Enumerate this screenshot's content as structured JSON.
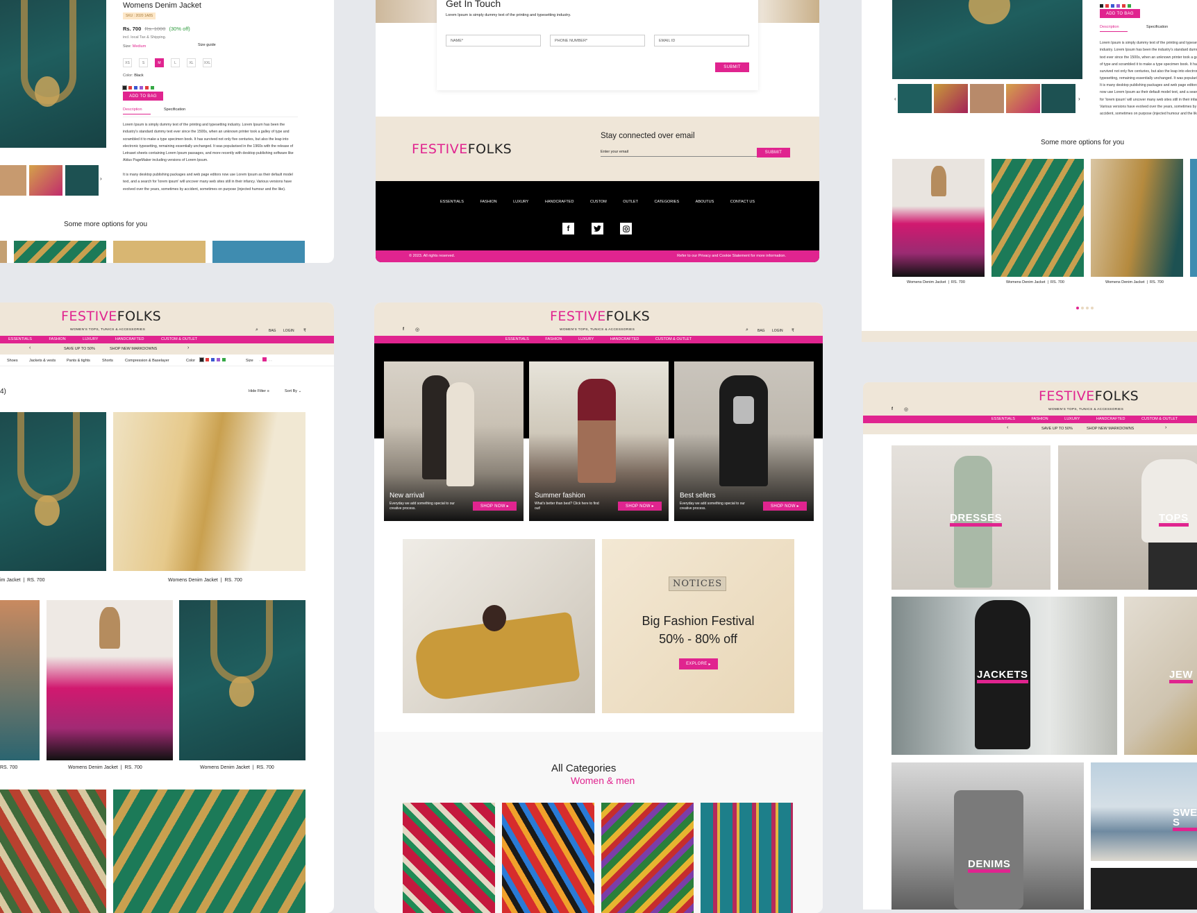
{
  "brand": {
    "part1": "FESTIVE",
    "part2": "FOLKS",
    "tagline": "WOMEN'S TOPS, TUNICS & ACCESSORIES"
  },
  "colors": {
    "accent": "#e0248f",
    "beige": "#efe6d8",
    "dark": "#000000"
  },
  "product": {
    "title": "Womens Denim Jacket",
    "sku": "SKU : 2020 1A8S",
    "price": "Rs. 700",
    "old_price": "Rs. 1000",
    "discount": "(30% off)",
    "tax": "incl. local Tax & Shipping.",
    "size_label": "Size:",
    "size_value": "Medium",
    "size_guide": "Size guide",
    "sizes": [
      "XS",
      "S",
      "M",
      "L",
      "XL",
      "XXL"
    ],
    "color_label": "Color:",
    "color_value": "Black",
    "add_to_bag": "ADD TO BAG",
    "tab_desc": "Description",
    "tab_spec": "Specification",
    "desc1": "Lorem Ipsum is simply dummy text of the printing and typesetting industry. Lorem Ipsum has been the industry's standard dummy text ever since the 1500s, when an unknown printer took a galley of type and scrambled it to make a type specimen book. It has survived not only five centuries, but also the leap into electronic typesetting, remaining essentially unchanged. It was popularised in the 1960s with the release of Letraset sheets containing Lorem Ipsum passages, and more recently with desktop publishing software like Aldus PageMaker including versions of Lorem Ipsum.",
    "desc2": "It is many desktop publishing packages and web page editors now use Lorem Ipsum as their default model text, and a search for 'lorem ipsum' will uncover many web sites still in their infancy. Various versions have evolved over the years, sometimes by accident, sometimes on purpose (injected humour and the like).",
    "more_options": "Some more options for you"
  },
  "contact": {
    "title": "Get In Touch",
    "subtitle": "Lorem Ipsum is simply dummy text of the printing and typesetting industry.",
    "name_ph": "NAME*",
    "phone_ph": "PHONE NUMBER*",
    "email_ph": "EMAIL ID",
    "submit": "SUBMIT"
  },
  "newsletter": {
    "title": "Stay connected over email",
    "placeholder": "Enter your email",
    "submit": "SUBMIT"
  },
  "footer": {
    "links": [
      "ESSENTIALS",
      "FASHION",
      "LUXURY",
      "HANDCRAFTED",
      "CUSTOM",
      "OUTLET",
      "CATEGORIES",
      "ABOUTUS",
      "CONTACT US"
    ],
    "copyright": "© 2023. All rights reserved.",
    "privacy": "Refer to our Privacy and Cookie Statement for more information."
  },
  "header": {
    "bag": "BAG",
    "login": "LOGIN",
    "currency": "₹"
  },
  "nav": [
    "ESSENTIALS",
    "FASHION",
    "LUXURY",
    "HANDCRAFTED",
    "CUSTOM & OUTLET"
  ],
  "promo": {
    "save": "SAVE UP TO 50%",
    "markdowns": "SHOP NEW MARKDOWNS"
  },
  "filters": {
    "items": [
      "Shoes",
      "Jackets & vests",
      "Pants & tights",
      "Shorts",
      "Compression & Baselayer"
    ],
    "color": "Color",
    "size": "Size",
    "count": "4)",
    "hide": "Hide Filter",
    "sort": "Sort By"
  },
  "listing": {
    "name": "Womens Denim Jacket",
    "partial_name": "im Jacket",
    "price": "RS. 700",
    "short_price": "RS. 700"
  },
  "hero": [
    {
      "title": "New arrival",
      "desc": "Everyday we add something special to our creative process.",
      "cta": "SHOP NOW"
    },
    {
      "title": "Summer fashion",
      "desc": "What's better than best? Click here to find out!",
      "cta": "SHOP NOW"
    },
    {
      "title": "Best sellers",
      "desc": "Everyday we add something special to our creative process.",
      "cta": "SHOP NOW"
    }
  ],
  "festival": {
    "sign": "NOTICES",
    "line1": "Big Fashion Festival",
    "line2": "50% - 80% off",
    "cta": "EXPLORE"
  },
  "categories_section": {
    "title": "All Categories",
    "subtitle": "Women & men"
  },
  "categories": [
    "DRESSES",
    "TOPS",
    "JACKETS",
    "JEW",
    "DENIMS",
    "SWEAT-S"
  ],
  "suggest": {
    "name": "Womens Denim Jacket",
    "price": "RS. 700"
  }
}
